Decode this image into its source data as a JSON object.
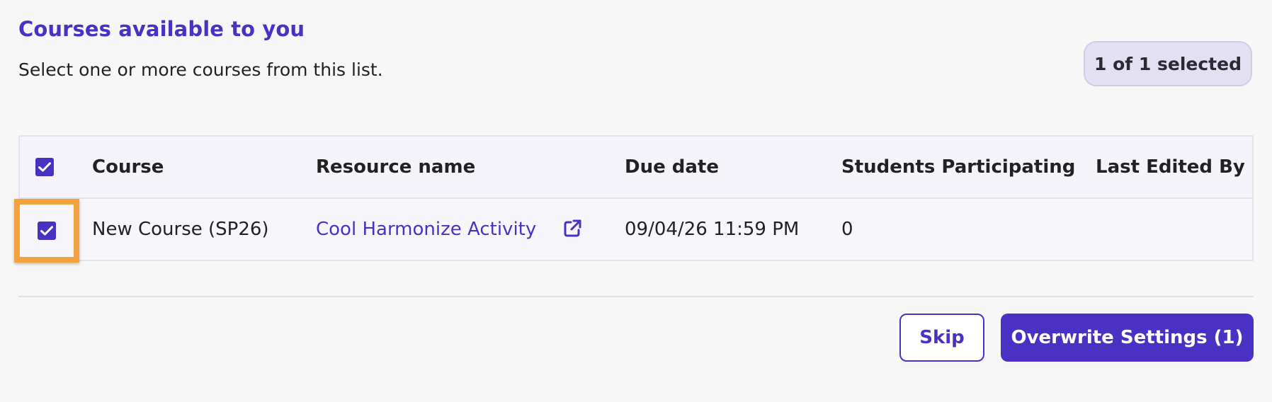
{
  "header": {
    "title": "Courses available to you",
    "subtitle": "Select one or more courses from this list.",
    "selected_badge": "1 of 1 selected"
  },
  "table": {
    "columns": [
      "Course",
      "Resource name",
      "Due date",
      "Students Participating",
      "Last Edited By"
    ],
    "select_all_checked": true,
    "rows": [
      {
        "checked": true,
        "course": "New Course (SP26)",
        "resource_name": "Cool Harmonize Activity",
        "due_date": "09/04/26 11:59 PM",
        "students_participating": "0",
        "last_edited_by": ""
      }
    ]
  },
  "icons": {
    "row_checkbox": "checkbox-checked-icon",
    "resource_link": "external-link-icon"
  },
  "actions": {
    "skip_label": "Skip",
    "overwrite_label": "Overwrite Settings (1)"
  },
  "colors": {
    "accent": "#4a31c4",
    "focus_highlight": "#f2a23e",
    "badge_bg": "#e3e0f3"
  }
}
